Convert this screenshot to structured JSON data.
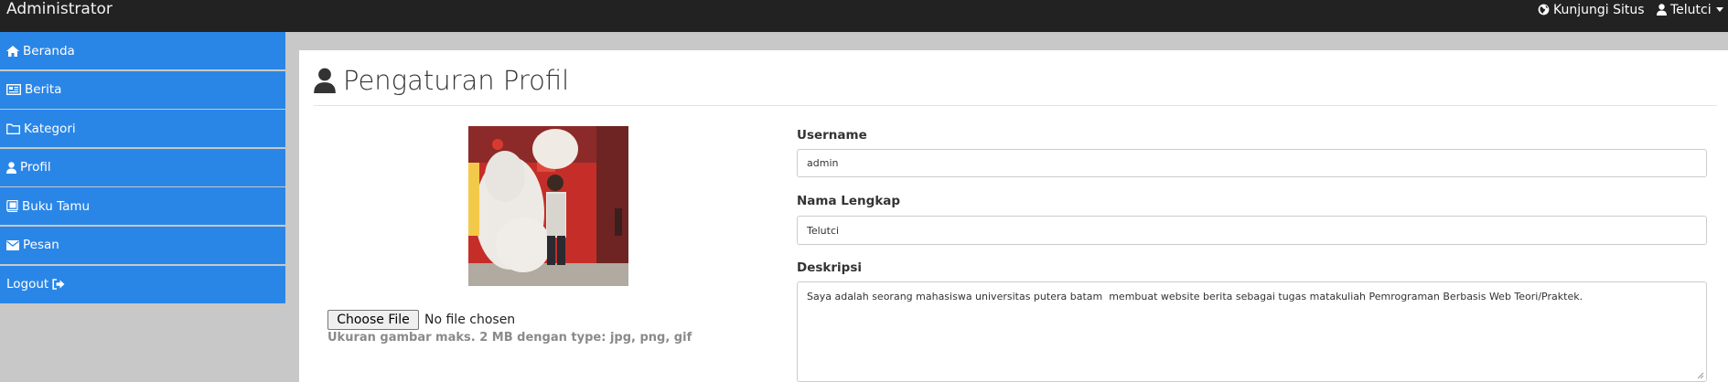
{
  "topbar": {
    "brand": "Administrator",
    "visit_site": "Kunjungi Situs",
    "user": "Telutci"
  },
  "sidebar": {
    "items": [
      {
        "label": "Beranda",
        "icon": "home-icon"
      },
      {
        "label": "Berita",
        "icon": "newspaper-icon"
      },
      {
        "label": "Kategori",
        "icon": "folder-icon"
      },
      {
        "label": "Profil",
        "icon": "user-icon"
      },
      {
        "label": "Buku Tamu",
        "icon": "book-icon"
      },
      {
        "label": "Pesan",
        "icon": "envelope-icon"
      },
      {
        "label": "Logout",
        "icon": "sign-out-icon"
      }
    ]
  },
  "page": {
    "title": "Pengaturan Profil"
  },
  "upload": {
    "button": "Choose File",
    "status": "No file chosen",
    "help": "Ukuran gambar maks. 2 MB dengan type: jpg, png, gif"
  },
  "form": {
    "username_label": "Username",
    "username_value": "admin",
    "fullname_label": "Nama Lengkap",
    "fullname_value": "Telutci",
    "description_label": "Deskripsi",
    "description_value": "Saya adalah seorang mahasiswa universitas putera batam  membuat website berita sebagai tugas matakuliah Pemrograman Berbasis Web Teori/Praktek."
  },
  "colors": {
    "topbar": "#222222",
    "sidebar_item": "#2a86e6",
    "page_bg": "#c8c8c8",
    "content_bg": "#ffffff"
  }
}
